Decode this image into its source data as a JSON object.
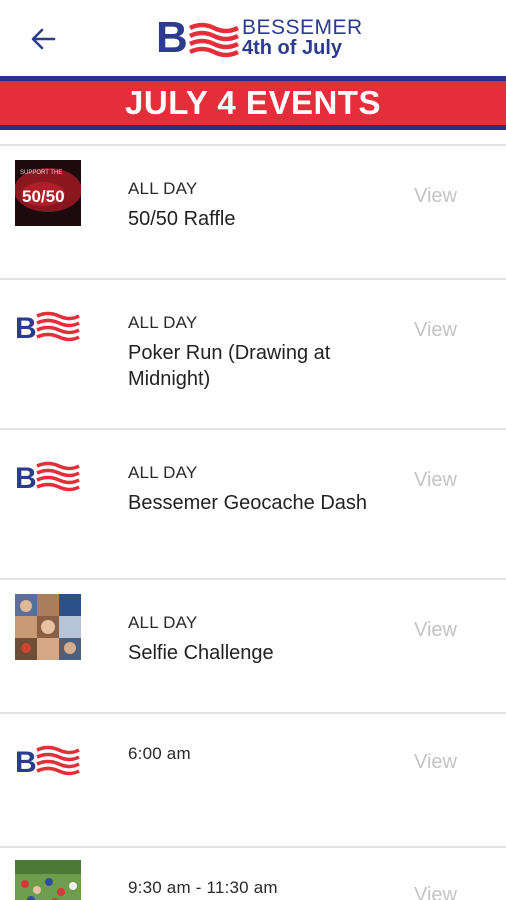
{
  "header": {
    "logo": {
      "letter": "B",
      "line1": "BESSEMER",
      "line2": "4th of July"
    },
    "back_icon": "arrow-left-icon"
  },
  "banner": {
    "title": "JULY 4 EVENTS"
  },
  "colors": {
    "navy": "#2b2f87",
    "red": "#e62d3a",
    "logo_blue": "#2b3b8f",
    "view_gray": "#c4c4c4"
  },
  "events": [
    {
      "time": "ALL DAY",
      "title": "50/50 Raffle",
      "thumb": "raffle-photo",
      "view": "View"
    },
    {
      "time": "ALL DAY",
      "title": "Poker Run (Drawing at Midnight)",
      "thumb": "bessemer-logo",
      "view": "View"
    },
    {
      "time": "ALL DAY",
      "title": "Bessemer Geocache Dash",
      "thumb": "bessemer-logo",
      "view": "View"
    },
    {
      "time": "ALL DAY",
      "title": "Selfie Challenge",
      "thumb": "selfie-collage-photo",
      "view": "View"
    },
    {
      "time": "6:00 am",
      "title": "",
      "thumb": "bessemer-logo",
      "view": "View"
    },
    {
      "time": "9:30 am - 11:30 am",
      "title": "",
      "thumb": "crowd-park-photo",
      "view": "View"
    }
  ],
  "thumb_text": {
    "raffle_big": "50/50",
    "raffle_small": "SUPPORT THE"
  }
}
